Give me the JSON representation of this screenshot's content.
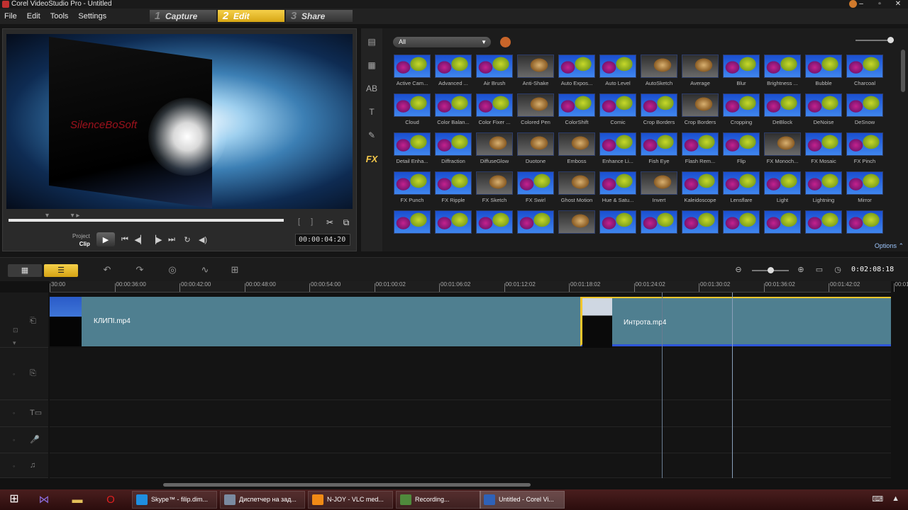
{
  "window": {
    "title": "Corel VideoStudio Pro - Untitled"
  },
  "menu": [
    "File",
    "Edit",
    "Tools",
    "Settings"
  ],
  "steps": [
    {
      "num": "1",
      "label": "Capture"
    },
    {
      "num": "2",
      "label": "Edit"
    },
    {
      "num": "3",
      "label": "Share"
    }
  ],
  "preview": {
    "watermark": "SilenceBoSoft",
    "mode_project": "Project",
    "mode_clip": "Clip",
    "timecode": "00:00:04:20"
  },
  "library": {
    "filter": "All",
    "options_label": "Options",
    "filters": [
      "Active Cam...",
      "Advanced ...",
      "Air Brush",
      "Anti-Shake",
      "Auto Expos...",
      "Auto Level",
      "AutoSketch",
      "Average",
      "Blur",
      "Brightness ...",
      "Bubble",
      "Charcoal",
      "Cloud",
      "Color Balan...",
      "Color Fixer ...",
      "Colored Pen",
      "ColorShift",
      "Comic",
      "Crop Borders",
      "Crop Borders",
      "Cropping",
      "DeBlock",
      "DeNoise",
      "DeSnow",
      "Detail Enha...",
      "Diffraction",
      "DiffuseGlow",
      "Duotone",
      "Emboss",
      "Enhance Li...",
      "Fish Eye",
      "Flash Rem...",
      "Flip",
      "FX Monoch...",
      "FX Mosaic",
      "FX Pinch",
      "FX Punch",
      "FX Ripple",
      "FX Sketch",
      "FX Swirl",
      "Ghost Motion",
      "Hue & Satu...",
      "Invert",
      "Kaleidoscope",
      "Lensflare",
      "Light",
      "Lightning",
      "Mirror",
      "",
      "",
      "",
      "",
      "",
      "",
      "",
      "",
      "",
      "",
      "",
      ""
    ]
  },
  "timeline": {
    "total_time": "0:02:08:18",
    "ruler": [
      "30:00",
      "00:00:36:00",
      "00:00:42:00",
      "00:00:48:00",
      "00:00:54:00",
      "00:01:00:02",
      "00:01:06:02",
      "00:01:12:02",
      "00:01:18:02",
      "00:01:24:02",
      "00:01:30:02",
      "00:01:36:02",
      "00:01:42:02",
      "00:01"
    ],
    "clips": [
      {
        "name": "КЛИПI.mp4"
      },
      {
        "name": "Интрота.mp4"
      }
    ]
  },
  "taskbar": {
    "apps": [
      {
        "label": "Skype™ - filip.dim...",
        "color": "#1f8fe0"
      },
      {
        "label": "Диспетчер на зад...",
        "color": "#7a8aa0"
      },
      {
        "label": "N-JOY - VLC med...",
        "color": "#f08a16"
      },
      {
        "label": "Recording...",
        "color": "#4f8a3c"
      },
      {
        "label": "Untitled - Corel Vi...",
        "color": "#2f62b8"
      }
    ]
  }
}
